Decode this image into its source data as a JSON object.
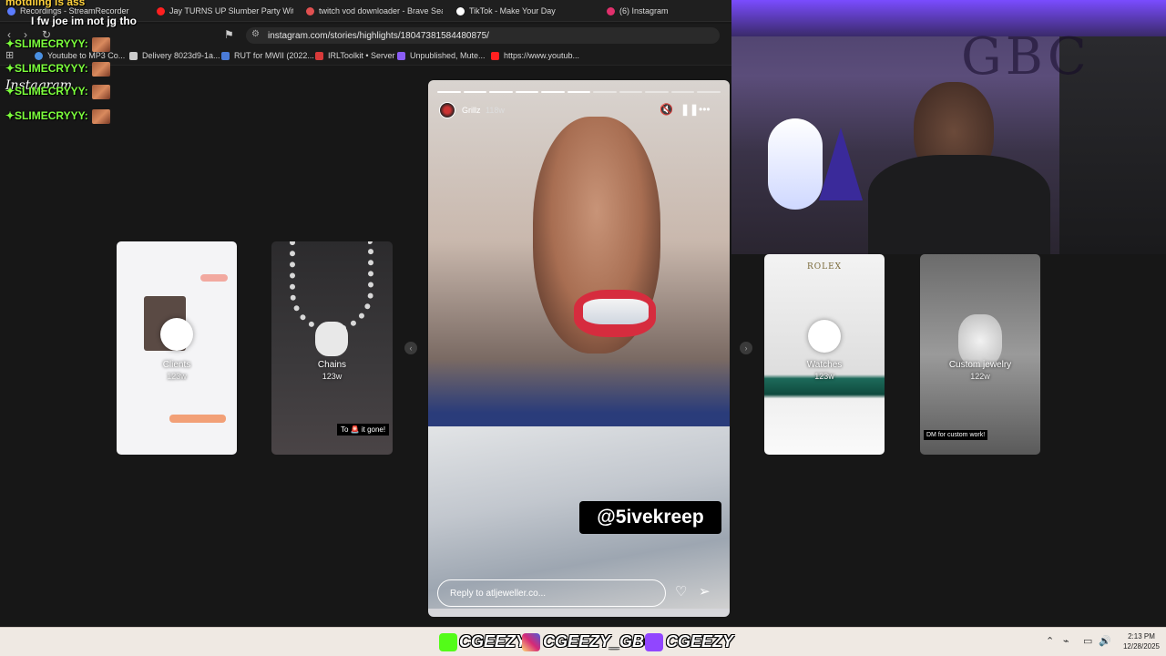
{
  "browser": {
    "tabs": [
      {
        "label": "Recordings - StreamRecorder",
        "icon_color": "#5b7cff"
      },
      {
        "label": "Jay TURNS UP Slumber Party With Br",
        "icon_color": "#ff2020"
      },
      {
        "label": "twitch vod downloader - Brave Searc",
        "icon_color": "#e05050"
      },
      {
        "label": "TikTok - Make Your Day",
        "icon_color": "#ffffff"
      },
      {
        "label": "(6) Instagram",
        "icon_color": "#e1306c"
      }
    ],
    "url": "instagram.com/stories/highlights/18047381584480875/",
    "bookmarks": [
      {
        "label": "Youtube to MP3 Co...",
        "icon_color": "#4a90e2"
      },
      {
        "label": "Delivery 8023d9-1a...",
        "icon_color": "#cccccc"
      },
      {
        "label": "RUT for MWII (2022...",
        "icon_color": "#4a7bd8"
      },
      {
        "label": "IRLToolkit • Server",
        "icon_color": "#d83a3a"
      },
      {
        "label": "Unpublished, Mute...",
        "icon_color": "#8a5cf5"
      },
      {
        "label": "https://www.youtub...",
        "icon_color": "#ff2020"
      }
    ]
  },
  "chat": [
    {
      "user": "",
      "message": "I fw joe im not jg tho",
      "user_color": "#ff3b3b"
    },
    {
      "user": "✦SLIMECRYYY:",
      "message": "",
      "user_color": "#7cff3c"
    },
    {
      "user": "✦SLIMECRYYY:",
      "message": "",
      "user_color": "#7cff3c"
    },
    {
      "user": "✦SLIMECRYYY:",
      "message": "",
      "user_color": "#7cff3c"
    },
    {
      "user": "✦SLIMECRYYY:",
      "message": "",
      "user_color": "#7cff3c"
    }
  ],
  "chat_top_partial": "motdling is ass",
  "instagram_overlay": "Instagram",
  "highlights": [
    {
      "label": "Clients",
      "age": "123w"
    },
    {
      "label": "Chains",
      "age": "123w",
      "caption": "To 🚨 it gone!"
    },
    {
      "label": "Watches",
      "age": "123w"
    },
    {
      "label": "Custom jewelry",
      "age": "122w",
      "caption": "DM for custom work!"
    }
  ],
  "story": {
    "username": "Grillz",
    "time_ago": "118w",
    "sticker_text": "@5ivekreep",
    "reply_placeholder": "Reply to atljeweller.co...",
    "progress_total": 11,
    "progress_done": 6
  },
  "watch_box_brand": "ROLEX",
  "webcam": {
    "wall_text": "GBC"
  },
  "taskbar": {
    "socials": [
      "CGEEZY",
      "CGEEZY_GBC",
      "CGEEZY"
    ],
    "time": "2:13 PM",
    "date": "12/28/2025"
  }
}
